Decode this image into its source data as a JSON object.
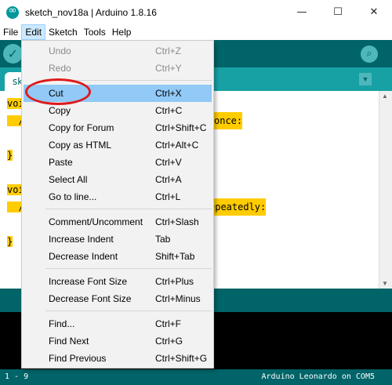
{
  "window": {
    "title": "sketch_nov18a | Arduino 1.8.16",
    "minimize": "—",
    "maximize": "☐",
    "close": "✕"
  },
  "menubar": [
    "File",
    "Edit",
    "Sketch",
    "Tools",
    "Help"
  ],
  "toolbar": {
    "verify_icon": "✓",
    "monitor_icon": "⌕"
  },
  "tab": {
    "label": "sk",
    "arrow": "▼"
  },
  "editor": {
    "lines": [
      {
        "a": "voi",
        "b": ""
      },
      {
        "a": "  /",
        "b": "once:"
      },
      {
        "a": "",
        "b": ""
      },
      {
        "a": "}",
        "b": ""
      },
      {
        "a": "",
        "b": ""
      },
      {
        "a": "voi",
        "b": ""
      },
      {
        "a": "  /",
        "b": "epeatedly:"
      },
      {
        "a": "",
        "b": ""
      },
      {
        "a": "}",
        "b": ""
      }
    ]
  },
  "statusbar": {
    "line": "1 - 9",
    "board": "Arduino Leonardo on COM5"
  },
  "edit_menu": {
    "groups": [
      [
        {
          "label": "Undo",
          "shortcut": "Ctrl+Z",
          "disabled": true
        },
        {
          "label": "Redo",
          "shortcut": "Ctrl+Y",
          "disabled": true
        }
      ],
      [
        {
          "label": "Cut",
          "shortcut": "Ctrl+X",
          "hover": true
        },
        {
          "label": "Copy",
          "shortcut": "Ctrl+C"
        },
        {
          "label": "Copy for Forum",
          "shortcut": "Ctrl+Shift+C"
        },
        {
          "label": "Copy as HTML",
          "shortcut": "Ctrl+Alt+C"
        },
        {
          "label": "Paste",
          "shortcut": "Ctrl+V"
        },
        {
          "label": "Select All",
          "shortcut": "Ctrl+A"
        },
        {
          "label": "Go to line...",
          "shortcut": "Ctrl+L"
        }
      ],
      [
        {
          "label": "Comment/Uncomment",
          "shortcut": "Ctrl+Slash"
        },
        {
          "label": "Increase Indent",
          "shortcut": "Tab"
        },
        {
          "label": "Decrease Indent",
          "shortcut": "Shift+Tab"
        }
      ],
      [
        {
          "label": "Increase Font Size",
          "shortcut": "Ctrl+Plus"
        },
        {
          "label": "Decrease Font Size",
          "shortcut": "Ctrl+Minus"
        }
      ],
      [
        {
          "label": "Find...",
          "shortcut": "Ctrl+F"
        },
        {
          "label": "Find Next",
          "shortcut": "Ctrl+G"
        },
        {
          "label": "Find Previous",
          "shortcut": "Ctrl+Shift+G"
        }
      ]
    ]
  },
  "colors": {
    "toolbar": "#006468",
    "tabrow": "#17a1a5",
    "code_highlight": "#ffcc00",
    "menu_hover": "#91c9f7",
    "annotation_ring": "#e0191b"
  }
}
